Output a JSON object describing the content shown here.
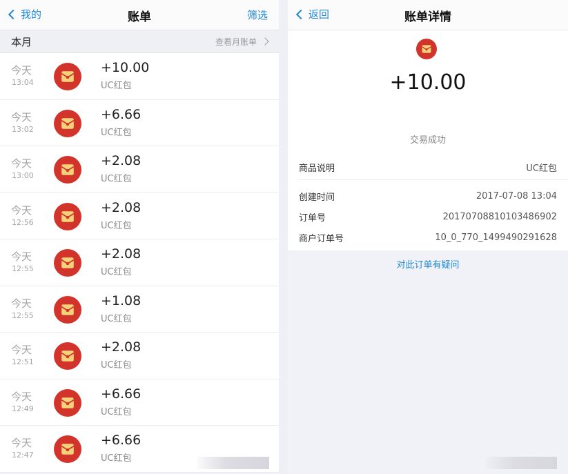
{
  "list_screen": {
    "back_label": "我的",
    "title": "账单",
    "filter_label": "筛选",
    "month_label": "本月",
    "month_link": "查看月账单",
    "rows": [
      {
        "day": "今天",
        "time": "13:04",
        "amount": "+10.00",
        "desc": "UC红包"
      },
      {
        "day": "今天",
        "time": "13:02",
        "amount": "+6.66",
        "desc": "UC红包"
      },
      {
        "day": "今天",
        "time": "13:00",
        "amount": "+2.08",
        "desc": "UC红包"
      },
      {
        "day": "今天",
        "time": "12:56",
        "amount": "+2.08",
        "desc": "UC红包"
      },
      {
        "day": "今天",
        "time": "12:55",
        "amount": "+2.08",
        "desc": "UC红包"
      },
      {
        "day": "今天",
        "time": "12:55",
        "amount": "+1.08",
        "desc": "UC红包"
      },
      {
        "day": "今天",
        "time": "12:51",
        "amount": "+2.08",
        "desc": "UC红包"
      },
      {
        "day": "今天",
        "time": "12:49",
        "amount": "+6.66",
        "desc": "UC红包"
      },
      {
        "day": "今天",
        "time": "12:47",
        "amount": "+6.66",
        "desc": "UC红包"
      }
    ]
  },
  "detail_screen": {
    "back_label": "返回",
    "title": "账单详情",
    "amount": "+10.00",
    "status": "交易成功",
    "product_label": "商品说明",
    "product_value": "UC红包",
    "fields": [
      {
        "label": "创建时间",
        "value": "2017-07-08 13:04"
      },
      {
        "label": "订单号",
        "value": "20170708810103486902"
      },
      {
        "label": "商户订单号",
        "value": "10_0_770_1499490291628"
      }
    ],
    "question_link": "对此订单有疑问"
  },
  "icons": {
    "list_icon": "red-packet-icon",
    "back_icon": "chevron-left-icon",
    "month_chevron": "chevron-right-icon"
  },
  "colors": {
    "accent": "#1e88d6",
    "packet_red": "#d2342b",
    "packet_gold": "#f3d37a"
  }
}
